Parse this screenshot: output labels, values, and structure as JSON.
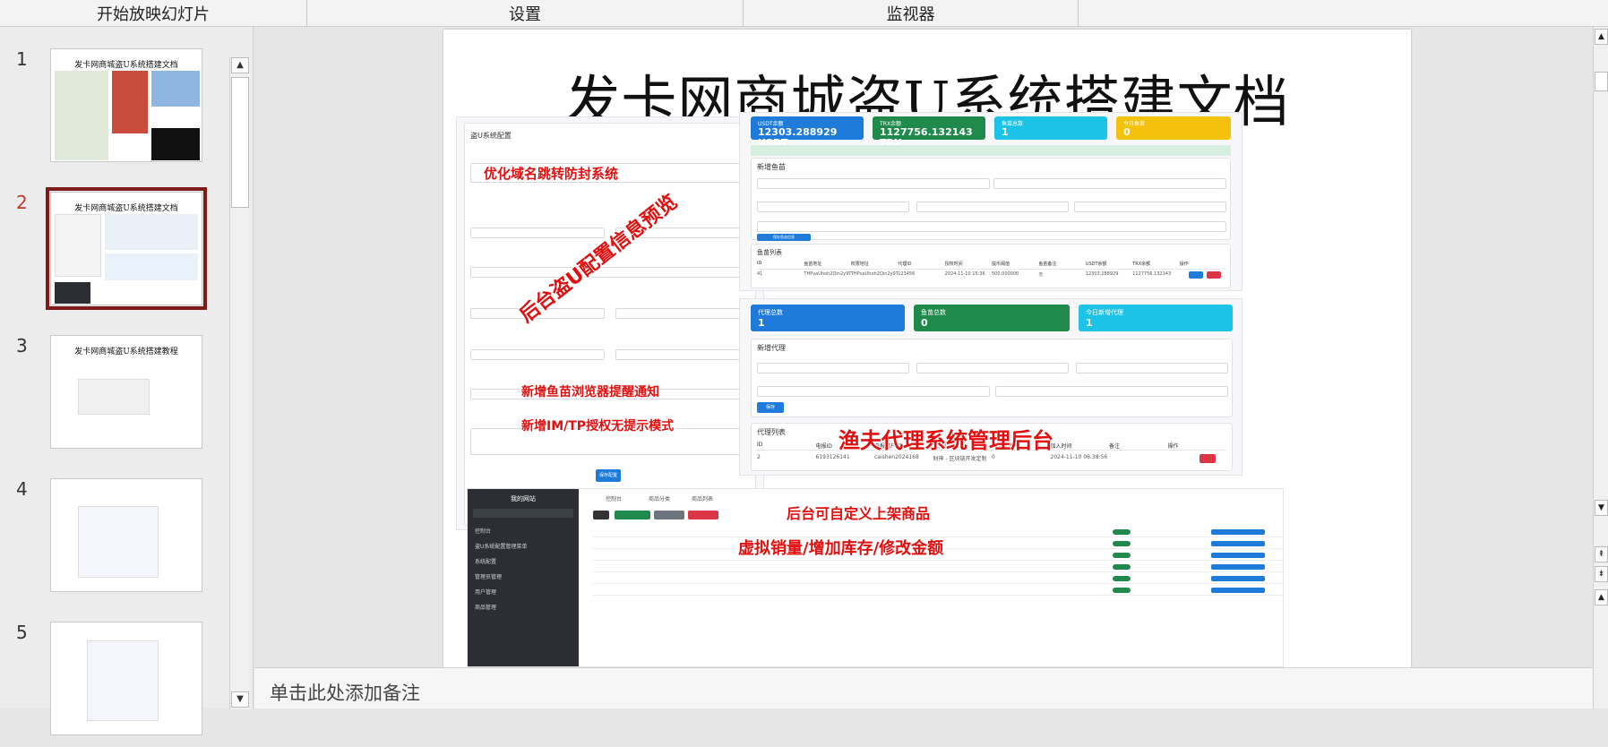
{
  "toolbar": {
    "groups": [
      "开始放映幻灯片",
      "设置",
      "监视器"
    ]
  },
  "slides_panel": {
    "slides": [
      {
        "number": "1",
        "title": "发卡网商城盗U系统搭建文档"
      },
      {
        "number": "2",
        "title": "发卡网商城盗U系统搭建文档"
      },
      {
        "number": "3",
        "title": "发卡网商城盗U系统搭建教程"
      },
      {
        "number": "4",
        "title": ""
      },
      {
        "number": "5",
        "title": ""
      }
    ],
    "active_index": 2
  },
  "slide": {
    "title": "发卡网商城盗U系统搭建文档",
    "overlays": {
      "domain_jump": "优化域名跳转防封系统",
      "admin_preview": "后台盗U配置信息预览",
      "new_address": "新增鱼苗浏览器提醒通知",
      "im_tp": "新增IM/TP授权无提示模式",
      "agent_admin": "渔夫代理系统管理后台",
      "custom_products": "后台可自定义上架商品",
      "virtual_sales": "虚拟销量/增加库存/修改金额"
    },
    "config_panel": {
      "header": "盗U系统配置",
      "save_label": "保存配置"
    },
    "stats": [
      {
        "label": "USDT余额",
        "value": "12303.288929 USDT",
        "color": "#1e7bd9"
      },
      {
        "label": "TRX余额",
        "value": "1127756.132143 TRX",
        "color": "#1f8a4c"
      },
      {
        "label": "鱼苗总数",
        "value": "1",
        "color": "#1cc3e6"
      },
      {
        "label": "今日鱼苗",
        "value": "0",
        "color": "#f4c20d"
      }
    ],
    "fish_panel": {
      "add_title": "新增鱼苗",
      "list_title": "鱼苗列表",
      "save_label": "保存鱼苗信息",
      "columns": [
        "ID",
        "鱼苗地址",
        "权限地址",
        "代理ID",
        "授权时间",
        "提币阈值",
        "鱼苗备注",
        "USDT余额",
        "TRX余额",
        "操作"
      ],
      "row": [
        "41",
        "THPvaUhoh2Qin2y9THCZ...",
        "THPvaUhoh2Qin2y9THCZ...",
        "123456",
        "2024-11-10 15:36",
        "500.000000",
        "无",
        "12303.288929",
        "1127756.132143",
        ""
      ]
    },
    "agent_stats": [
      {
        "label": "代理总数",
        "value": "1",
        "color": "#1e7bd9"
      },
      {
        "label": "鱼苗总数",
        "value": "0",
        "color": "#1f8a4c"
      },
      {
        "label": "今日新增代理",
        "value": "1",
        "color": "#1cc3e6"
      }
    ],
    "agent_panel": {
      "add_title": "新增代理",
      "list_title": "代理列表",
      "save_label": "保存",
      "columns": [
        "ID",
        "电报ID",
        "电报用户名",
        "电报昵称",
        "鱼苗数量",
        "加入时间",
        "备注",
        "操作"
      ],
      "row": [
        "2",
        "6193126141",
        "caishen2024168",
        "财神 - 区块链开发定制",
        "0",
        "2024-11-10 06:38:56",
        "",
        ""
      ]
    },
    "shop_panel": {
      "site_name": "我的网站",
      "menu": [
        "控制台",
        "盗U系统配置管理菜单",
        "系统配置",
        "管理员管理",
        "用户管理",
        "商品管理"
      ],
      "tabs": [
        "控制台",
        "商品分类",
        "商品列表"
      ]
    }
  },
  "notes": {
    "placeholder": "单击此处添加备注"
  }
}
